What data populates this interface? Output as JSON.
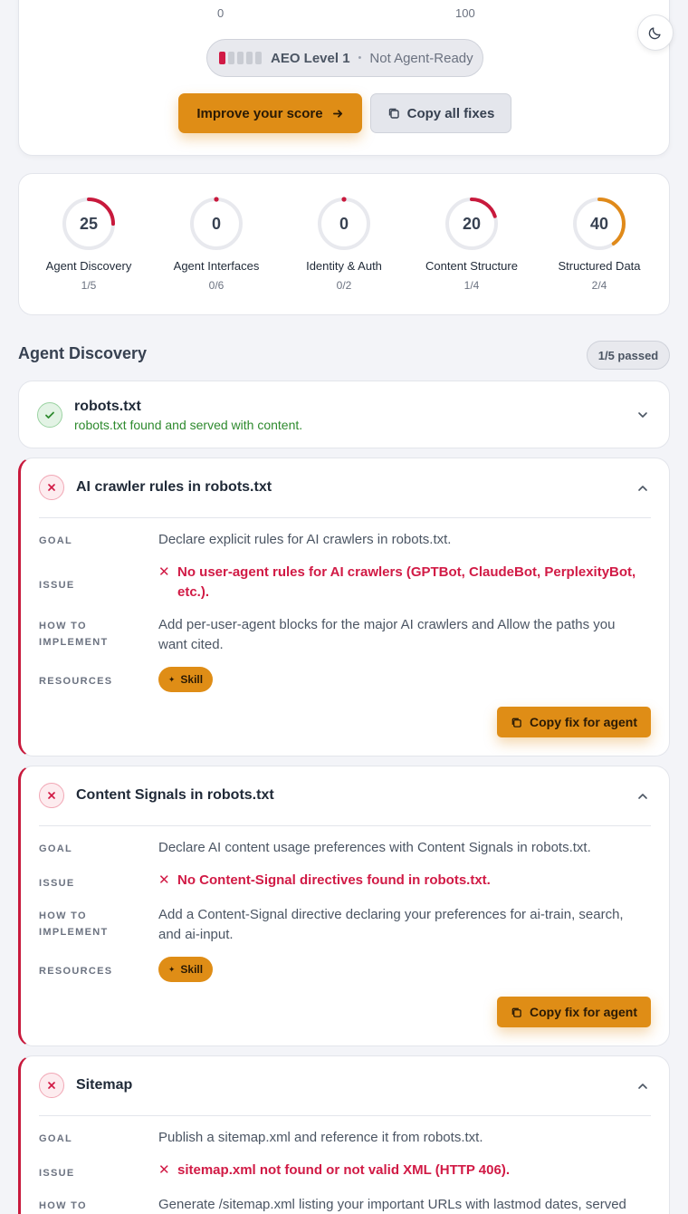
{
  "header": {
    "axis_min": "0",
    "axis_max": "100",
    "level": {
      "filled_bars": 1,
      "total_bars": 5,
      "name": "AEO Level 1",
      "separator": "•",
      "status": "Not Agent-Ready"
    },
    "improve_button": "Improve your score",
    "copy_all_button": "Copy all fixes",
    "theme_toggle_icon": "moon-icon"
  },
  "scores": [
    {
      "value": "25",
      "pct": 25,
      "color": "#c8193c",
      "name": "Agent Discovery",
      "frac": "1/5"
    },
    {
      "value": "0",
      "pct": 0,
      "color": "#c8193c",
      "name": "Agent Interfaces",
      "frac": "0/6"
    },
    {
      "value": "0",
      "pct": 0,
      "color": "#c8193c",
      "name": "Identity & Auth",
      "frac": "0/2"
    },
    {
      "value": "20",
      "pct": 20,
      "color": "#c8193c",
      "name": "Content Structure",
      "frac": "1/4"
    },
    {
      "value": "40",
      "pct": 40,
      "color": "#e08a1a",
      "name": "Structured Data",
      "frac": "2/4"
    }
  ],
  "section": {
    "title": "Agent Discovery",
    "passed": "1/5 passed"
  },
  "labels": {
    "goal": "GOAL",
    "issue": "ISSUE",
    "how_to_1": "HOW TO",
    "how_to_2": "IMPLEMENT",
    "resources": "RESOURCES",
    "skill": "Skill",
    "copy_fix": "Copy fix for agent"
  },
  "checks": [
    {
      "status": "pass",
      "title": "robots.txt",
      "summary": "robots.txt found and served with content."
    },
    {
      "status": "fail",
      "title": "AI crawler rules in robots.txt",
      "goal": "Declare explicit rules for AI crawlers in robots.txt.",
      "issue_line1": "No user-agent rules for AI crawlers (GPTBot, ClaudeBot, PerplexityBot,",
      "issue_line2": "etc.).",
      "how_line1": "Add per-user-agent blocks for the major AI crawlers and Allow the paths you",
      "how_line2": "want cited."
    },
    {
      "status": "fail",
      "title": "Content Signals in robots.txt",
      "goal": "Declare AI content usage preferences with Content Signals in robots.txt.",
      "issue_line1": "No Content-Signal directives found in robots.txt.",
      "how_line1": "Add a Content-Signal directive declaring your preferences for ai-train, search,",
      "how_line2": "and ai-input."
    },
    {
      "status": "fail",
      "title": "Sitemap",
      "goal": "Publish a sitemap.xml and reference it from robots.txt.",
      "issue_line1": "sitemap.xml not found or not valid XML (HTTP 406).",
      "how_line1": "Generate /sitemap.xml listing your important URLs with lastmod dates, served"
    }
  ]
}
